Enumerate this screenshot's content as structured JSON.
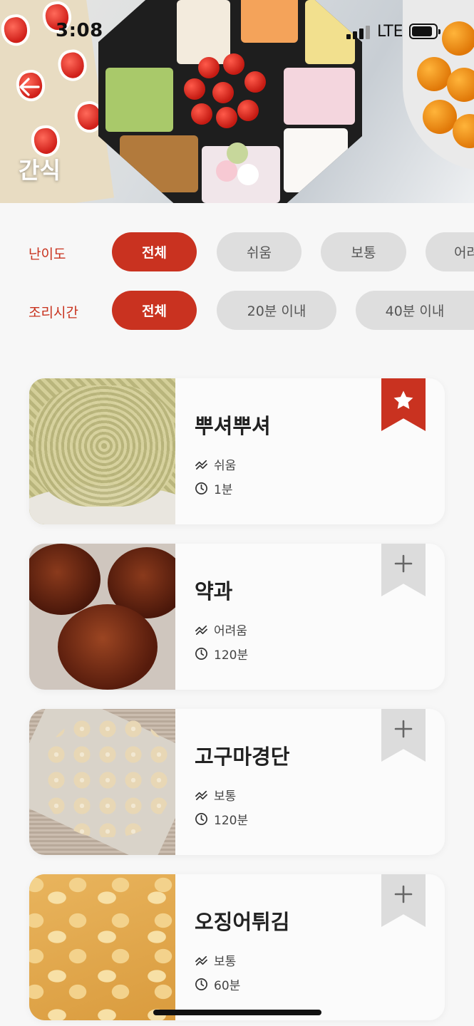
{
  "status_bar": {
    "time": "3:08",
    "network": "LTE"
  },
  "header": {
    "title": "간식"
  },
  "filters": {
    "difficulty": {
      "label": "난이도",
      "options": [
        "전체",
        "쉬움",
        "보통",
        "어려"
      ],
      "selected": "전체"
    },
    "cook_time": {
      "label": "조리시간",
      "options": [
        "전체",
        "20분 이내",
        "40분 이내"
      ],
      "selected": "전체"
    }
  },
  "recipes": [
    {
      "name": "뿌셔뿌셔",
      "difficulty": "쉬움",
      "time": "1분",
      "bookmarked": true
    },
    {
      "name": "약과",
      "difficulty": "어려움",
      "time": "120분",
      "bookmarked": false
    },
    {
      "name": "고구마경단",
      "difficulty": "보통",
      "time": "120분",
      "bookmarked": false
    },
    {
      "name": "오징어튀김",
      "difficulty": "보통",
      "time": "60분",
      "bookmarked": false
    }
  ],
  "colors": {
    "accent": "#c93220",
    "chip_inactive": "#dedede",
    "background": "#f7f7f7"
  },
  "icons": {
    "back": "arrow-left-icon",
    "bookmark_on": "star-icon",
    "bookmark_off": "plus-icon",
    "difficulty": "trend-icon",
    "time": "clock-icon"
  }
}
